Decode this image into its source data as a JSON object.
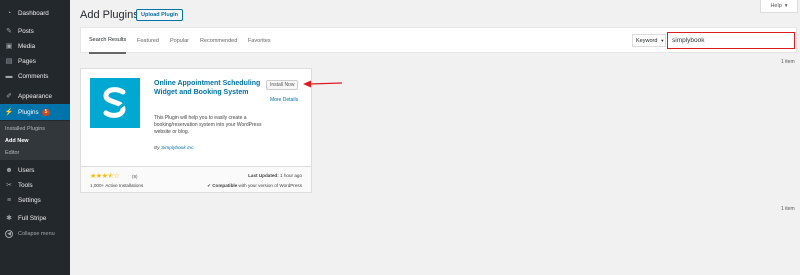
{
  "sidebar": {
    "items": [
      {
        "label": "Dashboard",
        "icon": "dashboard-icon"
      },
      {
        "label": "Posts",
        "icon": "pin-icon"
      },
      {
        "label": "Media",
        "icon": "media-icon"
      },
      {
        "label": "Pages",
        "icon": "page-icon"
      },
      {
        "label": "Comments",
        "icon": "comment-icon"
      },
      {
        "label": "Appearance",
        "icon": "brush-icon"
      },
      {
        "label": "Plugins",
        "icon": "plugin-icon",
        "badge": "5"
      },
      {
        "label": "Users",
        "icon": "users-icon"
      },
      {
        "label": "Tools",
        "icon": "wrench-icon"
      },
      {
        "label": "Settings",
        "icon": "sliders-icon"
      },
      {
        "label": "Full Stripe",
        "icon": "stripe-icon"
      }
    ],
    "submenu": [
      "Installed Plugins",
      "Add New",
      "Editor"
    ],
    "collapse_label": "Collapse menu"
  },
  "header": {
    "title": "Add Plugins",
    "upload_label": "Upload Plugin",
    "help_label": "Help"
  },
  "filter": {
    "tabs": [
      "Search Results",
      "Featured",
      "Popular",
      "Recommended",
      "Favorites"
    ],
    "keyword_label": "Keyword",
    "search_value": "simplybook"
  },
  "count_label": "1 item",
  "plugin": {
    "name": "Online Appointment Scheduling Widget and Booking System",
    "install_label": "Install Now",
    "more_details": "More Details",
    "description": "This Plugin will help you to easily create a booking/reservation system into your WordPress website or blog.",
    "author_prefix": "By",
    "author": "Simplybook Inc.",
    "rating_count": "(9)",
    "rating": 3.5,
    "installs": "1,000+ Active Installations",
    "last_updated_label": "Last Updated:",
    "last_updated_value": "1 hour ago",
    "compat_strong": "Compatible",
    "compat_rest": "with your version of WordPress"
  },
  "colors": {
    "sidebar_bg": "#23282d",
    "active": "#0073aa",
    "link": "#0073aa",
    "highlight": "#dd1b23",
    "icon_bg": "#01a9d2",
    "star": "#ffb900"
  }
}
